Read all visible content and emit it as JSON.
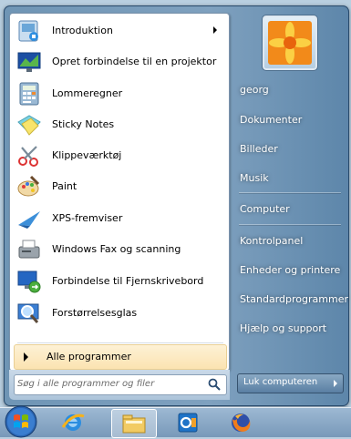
{
  "programs": [
    {
      "label": "Introduktion",
      "icon": "getting-started-icon",
      "submenu": true
    },
    {
      "label": "Opret forbindelse til en projektor",
      "icon": "projector-icon"
    },
    {
      "label": "Lommeregner",
      "icon": "calculator-icon"
    },
    {
      "label": "Sticky Notes",
      "icon": "sticky-notes-icon"
    },
    {
      "label": "Klippeværktøj",
      "icon": "snipping-tool-icon"
    },
    {
      "label": "Paint",
      "icon": "paint-icon"
    },
    {
      "label": "XPS-fremviser",
      "icon": "xps-viewer-icon"
    },
    {
      "label": "Windows Fax og scanning",
      "icon": "fax-scan-icon"
    },
    {
      "label": "Forbindelse til Fjernskrivebord",
      "icon": "remote-desktop-icon"
    },
    {
      "label": "Forstørrelsesglas",
      "icon": "magnifier-icon"
    }
  ],
  "all_programs_label": "Alle programmer",
  "search": {
    "placeholder": "Søg i alle programmer og filer"
  },
  "right_items": [
    "georg",
    "Dokumenter",
    "Billeder",
    "Musik",
    "Computer",
    "Kontrolpanel",
    "Enheder og printere",
    "Standardprogrammer",
    "Hjælp og support"
  ],
  "shutdown_label": "Luk computeren",
  "taskbar": {
    "icons": [
      "start-orb-icon",
      "internet-explorer-icon",
      "file-explorer-icon",
      "outlook-icon",
      "firefox-icon"
    ]
  },
  "colors": {
    "menu_frame": "#7fa1bf",
    "highlight": "#fbe3b1",
    "taskbar": "#8aa9c4"
  }
}
